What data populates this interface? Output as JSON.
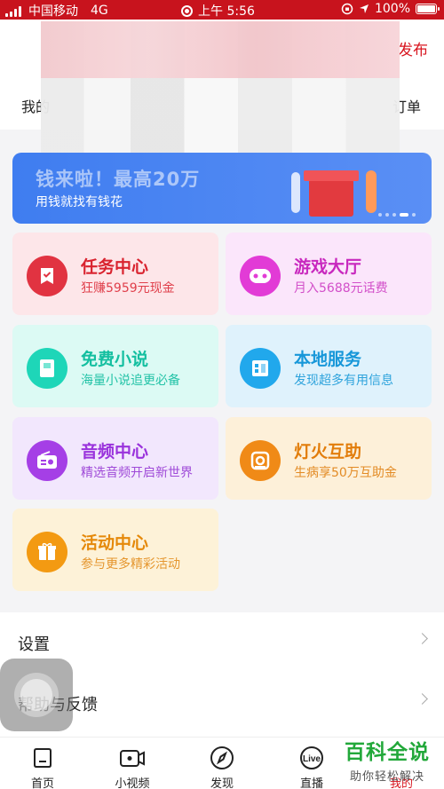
{
  "status_bar": {
    "carrier": "中国移动",
    "network": "4G",
    "time": "上午 5:56",
    "battery": "100%"
  },
  "header": {
    "publish": "发布",
    "mine_label": "我的",
    "order_label": "订单"
  },
  "banner": {
    "title": "钱来啦！最高20万",
    "subtitle": "用钱就找有钱花"
  },
  "cards": [
    {
      "title": "任务中心",
      "desc": "狂赚5959元现金",
      "color": "#e13341",
      "bg": "#fde6e9",
      "title_color": "#d9232f",
      "desc_color": "#e0404c",
      "icon": "task-icon"
    },
    {
      "title": "游戏大厅",
      "desc": "月入5688元话费",
      "color": "#e23bd6",
      "bg": "#fbe6fb",
      "title_color": "#c828be",
      "desc_color": "#d24fc9",
      "icon": "gamepad-icon"
    },
    {
      "title": "免费小说",
      "desc": "海量小说追更必备",
      "color": "#1ed6b8",
      "bg": "#dcfaf4",
      "title_color": "#14bfa0",
      "desc_color": "#23c3a7",
      "icon": "book-icon"
    },
    {
      "title": "本地服务",
      "desc": "发现超多有用信息",
      "color": "#21a8ec",
      "bg": "#dff2fc",
      "title_color": "#1797d9",
      "desc_color": "#2ea3dc",
      "icon": "building-icon"
    },
    {
      "title": "音频中心",
      "desc": "精选音频开启新世界",
      "color": "#a53fe6",
      "bg": "#f2e7fd",
      "title_color": "#9a33dc",
      "desc_color": "#9f4ad8",
      "icon": "radio-icon"
    },
    {
      "title": "灯火互助",
      "desc": "生病享50万互助金",
      "color": "#f08a17",
      "bg": "#fdf0d9",
      "title_color": "#e27d0b",
      "desc_color": "#e38b25",
      "icon": "mutual-aid-icon"
    },
    {
      "title": "活动中心",
      "desc": "参与更多精彩活动",
      "color": "#f39a12",
      "bg": "#fdf2d8",
      "title_color": "#e5890a",
      "desc_color": "#e5962e",
      "icon": "gift-icon"
    }
  ],
  "settings": {
    "settings_label": "设置",
    "help_label": "帮助与反馈"
  },
  "tabbar": {
    "items": [
      {
        "label": "首页",
        "icon": "home-icon"
      },
      {
        "label": "小视频",
        "icon": "video-icon"
      },
      {
        "label": "发现",
        "icon": "compass-icon"
      },
      {
        "label": "直播",
        "icon": "live-icon"
      },
      {
        "label": "我的",
        "icon": "profile-icon"
      }
    ]
  },
  "watermark": {
    "title": "百科全说",
    "subtitle": "助你轻松解决"
  }
}
